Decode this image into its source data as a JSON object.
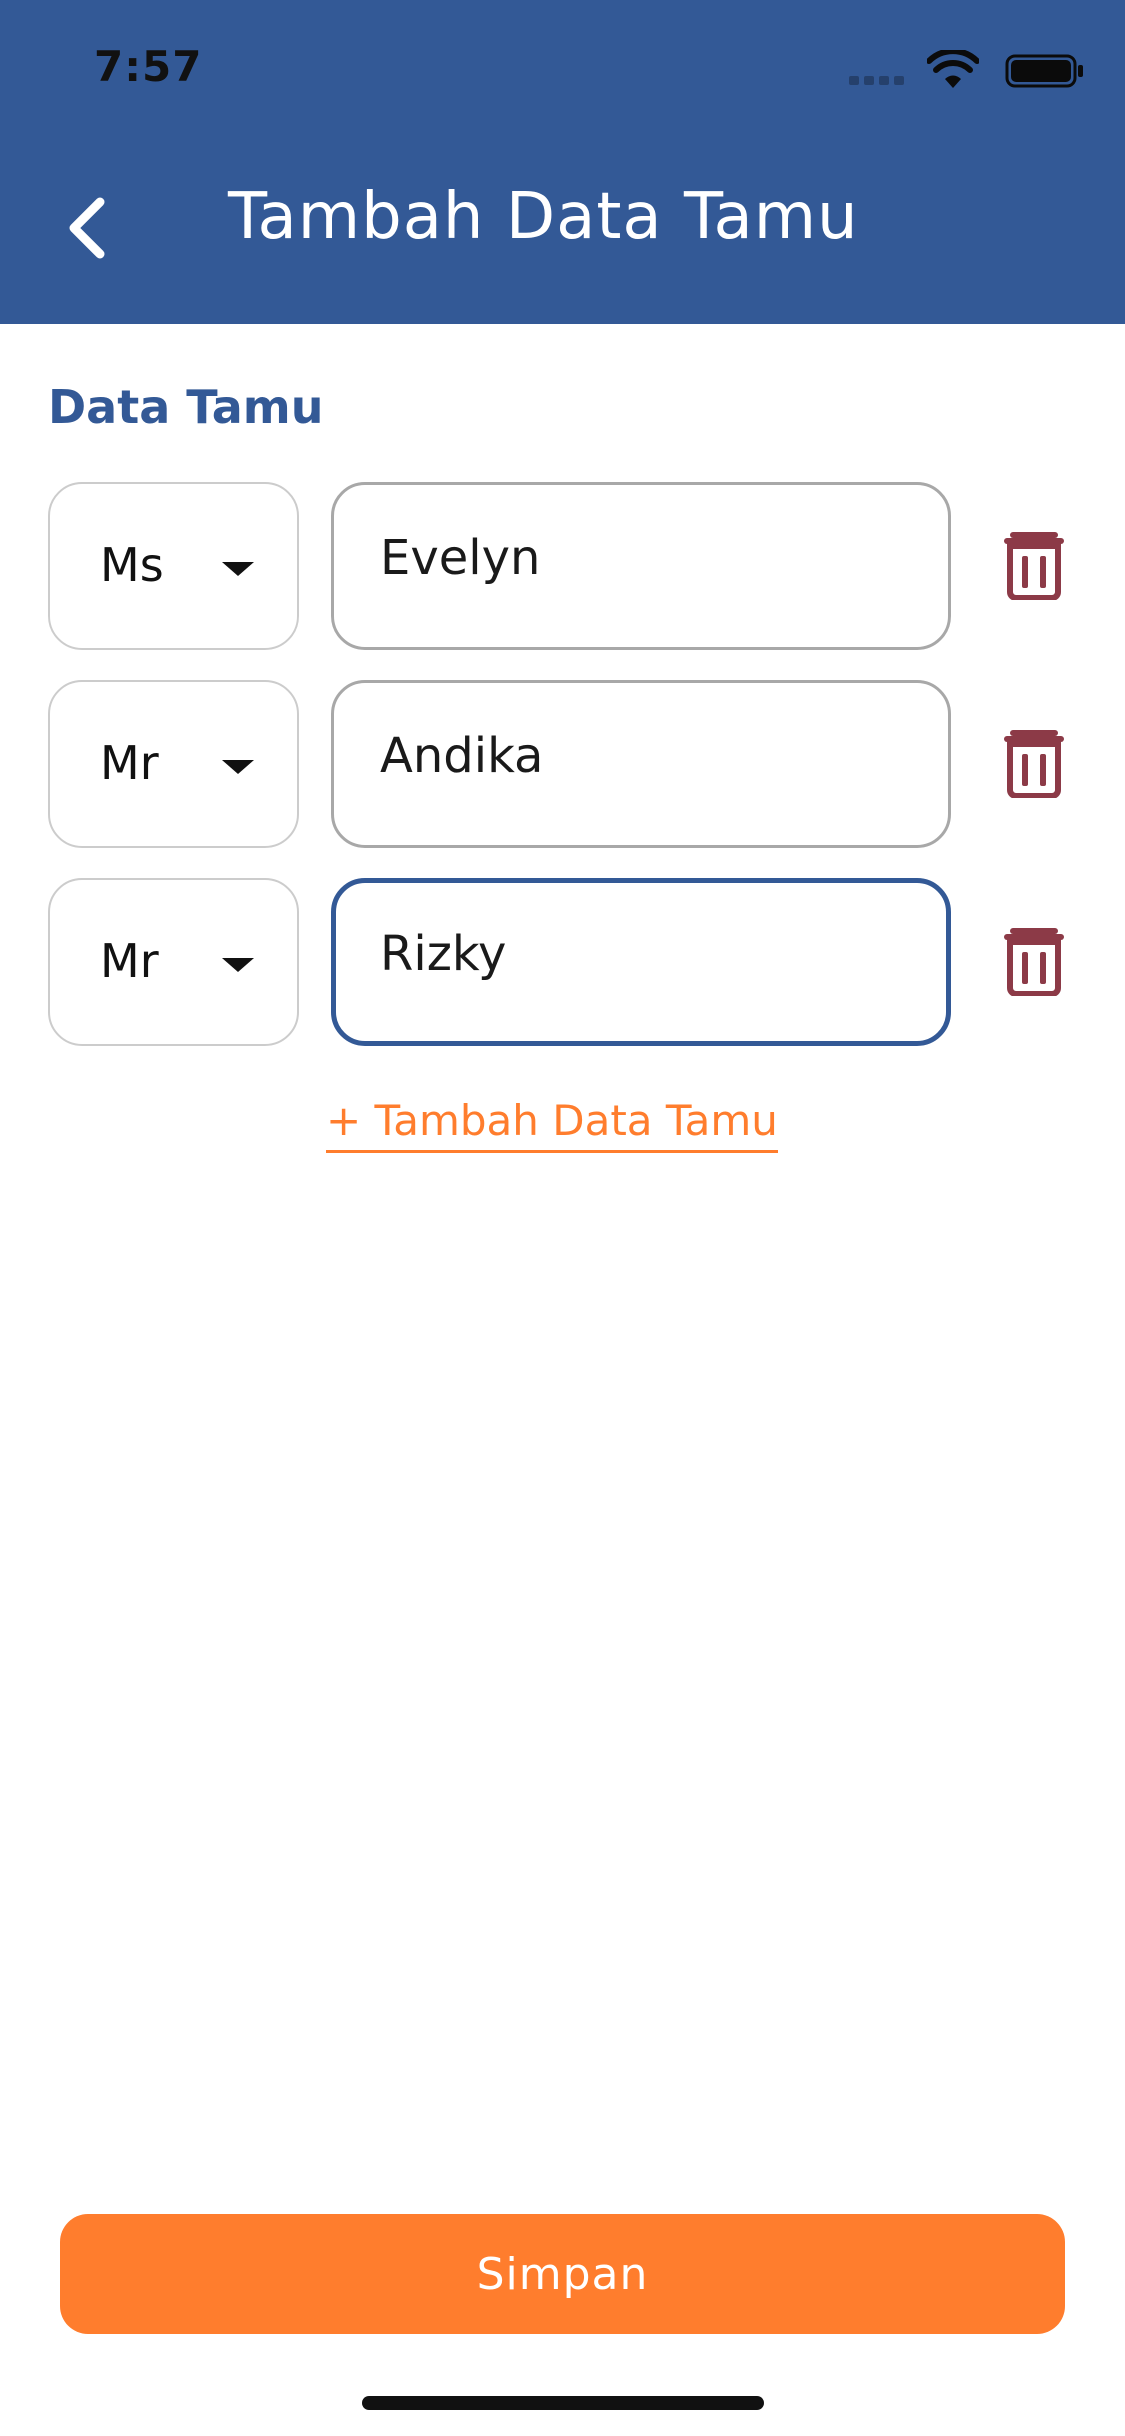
{
  "status_bar": {
    "time": "7:57",
    "icons": [
      "signal-icon",
      "wifi-icon",
      "battery-icon"
    ]
  },
  "header": {
    "title": "Tambah Data Tamu",
    "back_icon": "chevron-left-icon",
    "background_color": "#335996"
  },
  "section": {
    "title": "Data Tamu"
  },
  "guests": [
    {
      "title": "Ms",
      "name": "Evelyn",
      "focused": false
    },
    {
      "title": "Mr",
      "name": "Andika",
      "focused": false
    },
    {
      "title": "Mr",
      "name": "Rizky",
      "focused": true
    }
  ],
  "add_link": {
    "label": "+ Tambah Data Tamu"
  },
  "save_button": {
    "label": "Simpan",
    "color": "#ff7d2d"
  },
  "colors": {
    "primary": "#335996",
    "accent": "#ff7d2d",
    "delete": "#8c3a47"
  }
}
